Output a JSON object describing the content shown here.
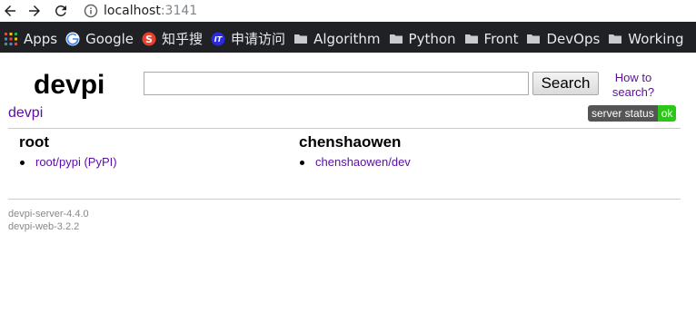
{
  "browser": {
    "url_host": "localhost",
    "url_port": ":3141",
    "bookmarks": [
      {
        "label": "Apps",
        "icon": "apps-grid-icon"
      },
      {
        "label": "Google",
        "icon": "google-icon"
      },
      {
        "label": "知乎搜",
        "icon": "zhihu-sogou-icon"
      },
      {
        "label": "申请访问",
        "icon": "it-icon"
      },
      {
        "label": "Algorithm",
        "icon": "folder-icon"
      },
      {
        "label": "Python",
        "icon": "folder-icon"
      },
      {
        "label": "Front",
        "icon": "folder-icon"
      },
      {
        "label": "DevOps",
        "icon": "folder-icon"
      },
      {
        "label": "Working",
        "icon": "folder-icon"
      }
    ]
  },
  "header": {
    "logo": "devpi",
    "sub_logo": "devpi",
    "search_value": "",
    "search_button": "Search",
    "howto_link": "How to search?",
    "server_status_label": "server status",
    "server_status_value": "ok"
  },
  "users": [
    {
      "name": "root",
      "indexes": [
        "root/pypi (PyPI)"
      ]
    },
    {
      "name": "chenshaowen",
      "indexes": [
        "chenshaowen/dev"
      ]
    }
  ],
  "footer": {
    "server_version": "devpi-server-4.4.0",
    "web_version": "devpi-web-3.2.2"
  },
  "colors": {
    "link": "#5b0da6",
    "status_ok": "#2bc718",
    "status_label": "#555555"
  }
}
